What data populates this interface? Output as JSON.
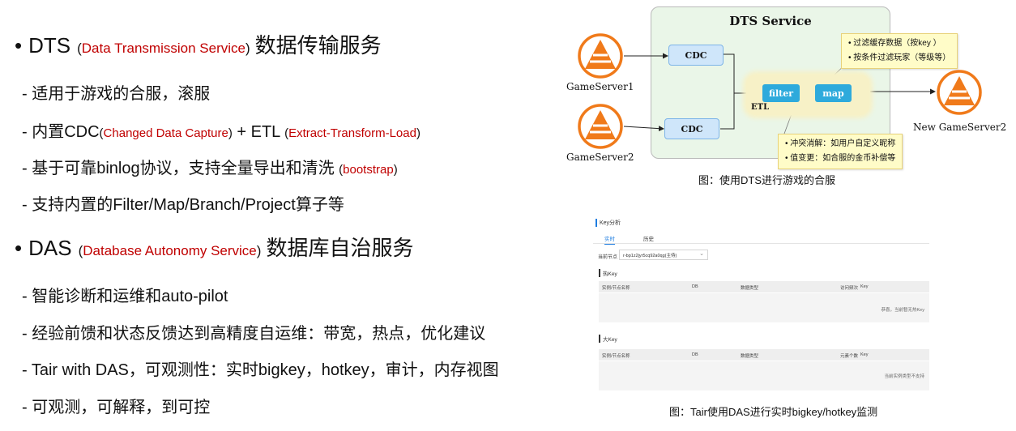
{
  "left": {
    "dts": {
      "bullet": "•",
      "name": "DTS",
      "paren_open": "(",
      "full": "Data Transmission Service",
      "paren_close": ")",
      "cn": "数据传输服务",
      "items": [
        {
          "text": "- 适用于游戏的合服，滚服"
        },
        {
          "text": "- 内置CDC ",
          "p1o": "(",
          "r1": "Changed Data Capture",
          "p1c": ")",
          "mid": " + ETL ",
          "p2o": "(",
          "r2": "Extract-Transform-Load",
          "p2c": ")"
        },
        {
          "text": "- 基于可靠binlog协议，支持全量导出和清洗 ",
          "p1o": "(",
          "r1": "bootstrap",
          "p1c": ")"
        },
        {
          "text": "- 支持内置的Filter/Map/Branch/Project算子等"
        }
      ]
    },
    "das": {
      "bullet": "•",
      "name": "DAS",
      "paren_open": "(",
      "full": "Database Autonomy Service",
      "paren_close": ")",
      "cn": "数据库自治服务",
      "items": [
        "- 智能诊断和运维和auto-pilot",
        "- 经验前馈和状态反馈达到高精度自运维：带宽，热点，优化建议",
        "- Tair with DAS，可观测性：实时bigkey，hotkey，审计，内存视图",
        "- 可观测，可解释，到可控"
      ]
    }
  },
  "dts_diagram": {
    "service_title": "DTS Service",
    "cdc1": "CDC",
    "cdc2": "CDC",
    "filter": "filter",
    "map": "map",
    "etl": "ETL",
    "note_top": [
      "•  过滤缓存数据（按key ）",
      "•  按条件过滤玩家（等级等）"
    ],
    "note_bottom": [
      "•  冲突消解：如用户自定义昵称",
      "•  值变更：如合服的金币补偿等"
    ],
    "server1": "GameServer1",
    "server2": "GameServer2",
    "server_new": "New GameServer2",
    "caption": "图：使用DTS进行游戏的合服",
    "icon_color": "#f07a1a"
  },
  "das_panel": {
    "title": "Key分析",
    "tab_realtime": "实时",
    "tab_history": "历史",
    "node_label": "当前节点",
    "node_value": "r-bp1z2jyr5cq92a0qg(主侍)",
    "hot_title": "热Key",
    "big_title": "大Key",
    "hot_cols": [
      "实例/节点名称",
      "DB",
      "数据类型",
      "访问频次",
      "Key"
    ],
    "big_cols": [
      "实例/节点名称",
      "DB",
      "数据类型",
      "元素个数",
      "Key"
    ],
    "hot_empty": "恭喜，当前暂无热Key",
    "big_empty": "当前实例类型不支持",
    "caption": "图：Tair使用DAS进行实时bigkey/hotkey监测"
  }
}
